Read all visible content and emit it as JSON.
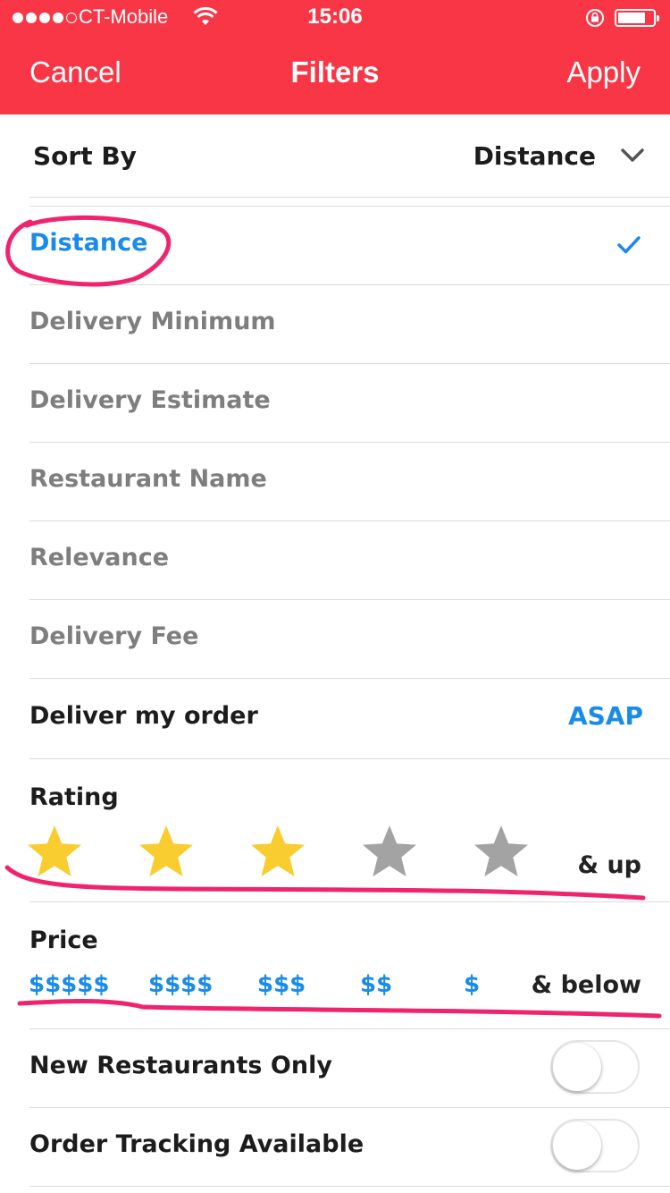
{
  "status_bar": {
    "carrier": "CT-Mobile",
    "time": "15:06",
    "signal_bars": 4,
    "signal_total": 5,
    "battery_level": 0.8
  },
  "nav": {
    "cancel": "Cancel",
    "title": "Filters",
    "apply": "Apply"
  },
  "sort_by": {
    "label": "Sort By",
    "value": "Distance",
    "options": [
      {
        "label": "Distance",
        "selected": true
      },
      {
        "label": "Delivery Minimum",
        "selected": false
      },
      {
        "label": "Delivery Estimate",
        "selected": false
      },
      {
        "label": "Restaurant Name",
        "selected": false
      },
      {
        "label": "Relevance",
        "selected": false
      },
      {
        "label": "Delivery Fee",
        "selected": false
      }
    ]
  },
  "deliver": {
    "label": "Deliver my order",
    "value": "ASAP"
  },
  "rating": {
    "label": "Rating",
    "stars_total": 5,
    "stars_selected": 3,
    "suffix": "& up"
  },
  "price": {
    "label": "Price",
    "levels": [
      "$$$$$",
      "$$$$",
      "$$$",
      "$$",
      "$"
    ],
    "suffix": "& below"
  },
  "toggles": [
    {
      "label": "New Restaurants Only",
      "on": false
    },
    {
      "label": "Order Tracking Available",
      "on": false
    }
  ],
  "colors": {
    "brand": "#f83646",
    "accent": "#1b8be8",
    "star_on": "#f9cd2f",
    "star_off": "#a3a3a3",
    "annotation": "#f0246e"
  }
}
